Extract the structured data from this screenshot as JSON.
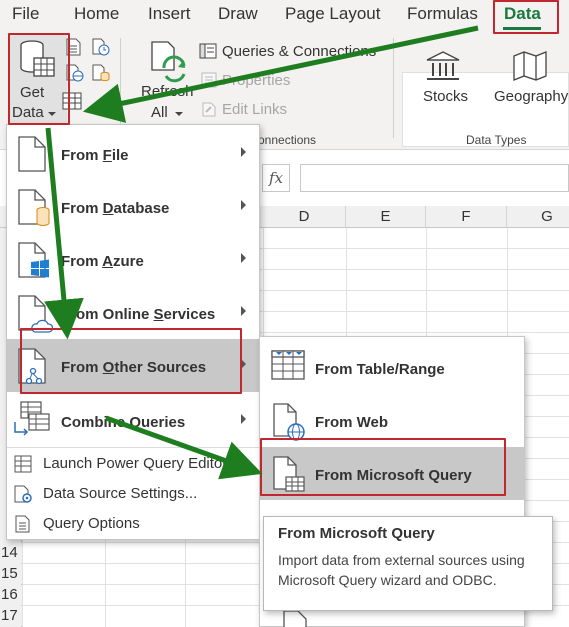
{
  "ribbon_tabs": [
    "File",
    "Home",
    "Insert",
    "Draw",
    "Page Layout",
    "Formulas",
    "Data"
  ],
  "ribbon": {
    "get_data_line1": "Get",
    "get_data_line2": "Data",
    "refresh_line1": "Refresh",
    "refresh_line2": "All",
    "queries_connections": "Queries & Connections",
    "properties": "Properties",
    "edit_links": "Edit Links",
    "connections_group": "onnections",
    "stocks": "Stocks",
    "geography": "Geography",
    "data_types_group": "Data Types"
  },
  "formula_bar": {
    "fx": "fx"
  },
  "columns": [
    "D",
    "E",
    "F",
    "G"
  ],
  "rows": [
    "14",
    "15",
    "16",
    "17"
  ],
  "menu": {
    "items": [
      {
        "label": "From File",
        "mnemonic": "F",
        "icon": "file-icon"
      },
      {
        "label": "From Database",
        "mnemonic": "D",
        "icon": "database-icon"
      },
      {
        "label": "From Azure",
        "mnemonic": "A",
        "icon": "azure-icon"
      },
      {
        "label": "From Online Services",
        "mnemonic": "S",
        "icon": "online-services-icon"
      },
      {
        "label": "From Other Sources",
        "mnemonic": "O",
        "icon": "other-sources-icon"
      },
      {
        "label": "Combine Queries",
        "mnemonic": "",
        "icon": "combine-queries-icon"
      }
    ],
    "small_items": [
      {
        "label": "Launch Power Query Editor...",
        "icon": "power-query-icon"
      },
      {
        "label": "Data Source Settings...",
        "icon": "data-source-settings-icon"
      },
      {
        "label": "Query Options",
        "icon": "query-options-icon"
      }
    ]
  },
  "submenu": {
    "items": [
      {
        "label": "From Table/Range",
        "icon": "table-range-icon"
      },
      {
        "label": "From Web",
        "icon": "web-icon"
      },
      {
        "label": "From Microsoft Query",
        "icon": "microsoft-query-icon"
      }
    ]
  },
  "tooltip": {
    "title": "From Microsoft Query",
    "body": "Import data from external sources using Microsoft Query wizard and ODBC."
  },
  "colors": {
    "accent_green": "#1a7a3e",
    "annotation_arrow": "#1e7d1e",
    "highlight_red": "#c0282d",
    "hover_gray": "#c8c8c8"
  }
}
